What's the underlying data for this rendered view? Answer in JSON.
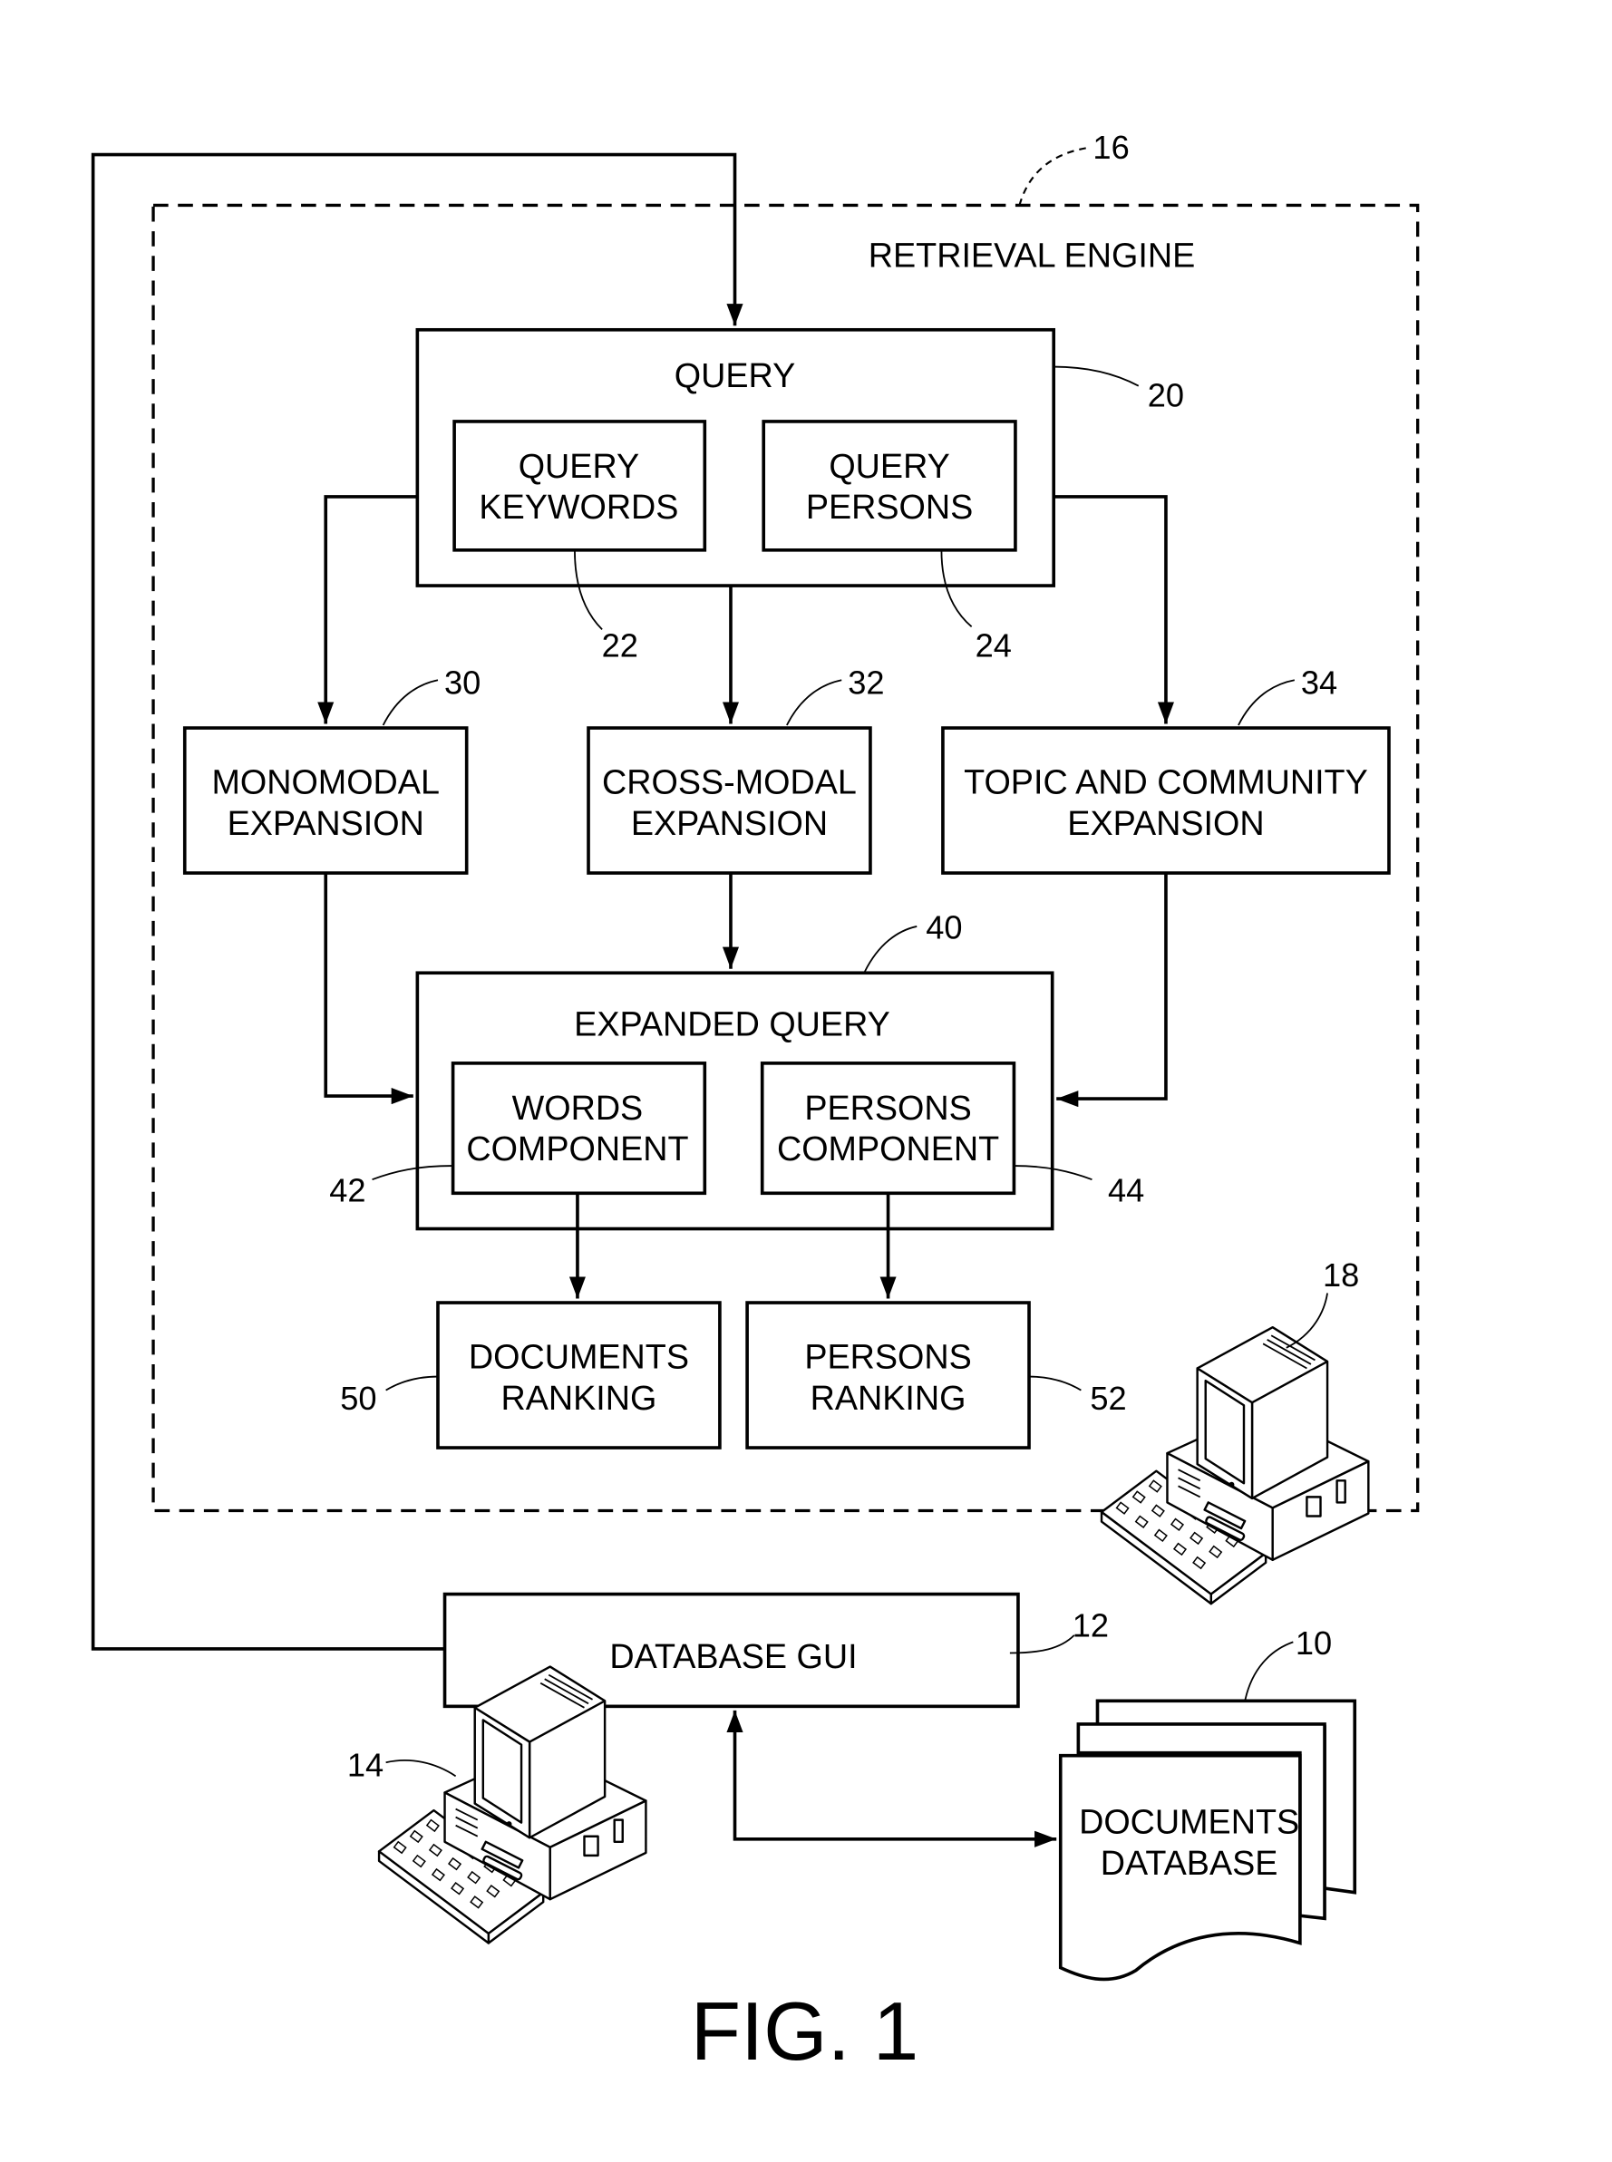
{
  "figure": {
    "caption": "FIG. 1",
    "engine": {
      "label": "RETRIEVAL ENGINE",
      "ref": "16"
    },
    "query": {
      "label": "QUERY",
      "ref": "20"
    },
    "query_keywords": {
      "line1": "QUERY",
      "line2": "KEYWORDS",
      "ref": "22"
    },
    "query_persons": {
      "line1": "QUERY",
      "line2": "PERSONS",
      "ref": "24"
    },
    "monomodal": {
      "line1": "MONOMODAL",
      "line2": "EXPANSION",
      "ref": "30"
    },
    "crossmodal": {
      "line1": "CROSS-MODAL",
      "line2": "EXPANSION",
      "ref": "32"
    },
    "topic": {
      "line1": "TOPIC AND COMMUNITY",
      "line2": "EXPANSION",
      "ref": "34"
    },
    "expanded_query": {
      "label": "EXPANDED QUERY",
      "ref": "40"
    },
    "words_component": {
      "line1": "WORDS",
      "line2": "COMPONENT",
      "ref": "42"
    },
    "persons_component": {
      "line1": "PERSONS",
      "line2": "COMPONENT",
      "ref": "44"
    },
    "documents_ranking": {
      "line1": "DOCUMENTS",
      "line2": "RANKING",
      "ref": "50"
    },
    "persons_ranking": {
      "line1": "PERSONS",
      "line2": "RANKING",
      "ref": "52"
    },
    "computer_engine": {
      "ref": "18",
      "icon": "desktop-computer-icon"
    },
    "database_gui": {
      "label": "DATABASE GUI",
      "ref": "12"
    },
    "computer_user": {
      "ref": "14",
      "icon": "desktop-computer-icon"
    },
    "documents_database": {
      "line1": "DOCUMENTS",
      "line2": "DATABASE",
      "ref": "10",
      "icon": "document-stack-icon"
    }
  }
}
